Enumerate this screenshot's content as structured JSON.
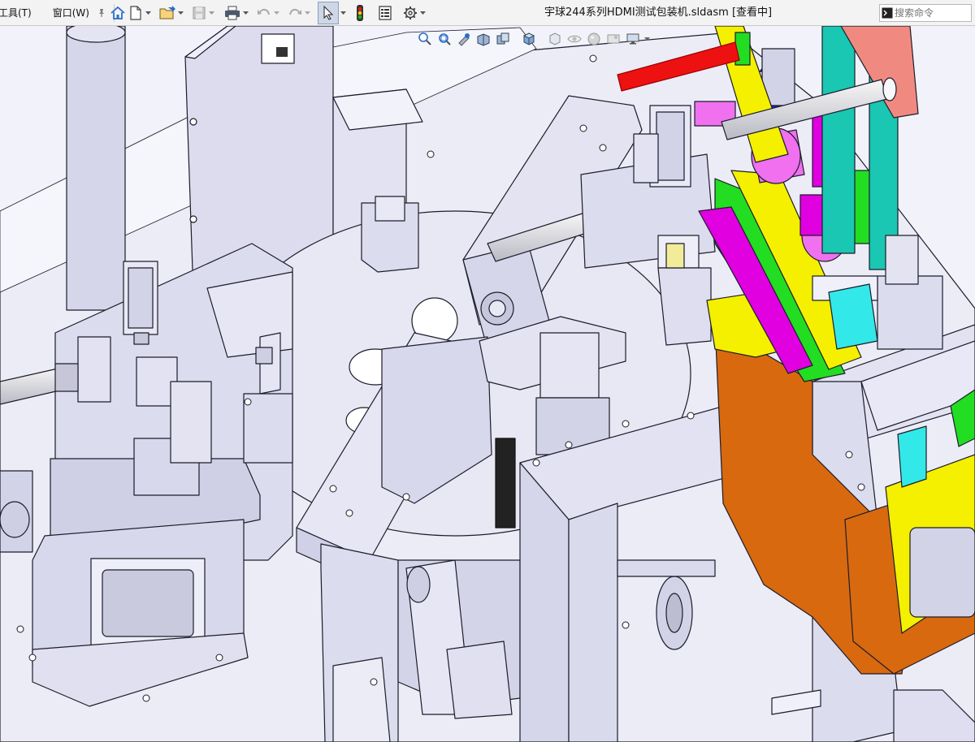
{
  "menu": {
    "items": [
      {
        "label": "工具(T)"
      },
      {
        "label": "窗口(W)"
      }
    ]
  },
  "window": {
    "title": "宇球244系列HDMI测试包装机.sldasm [查看中]"
  },
  "search": {
    "placeholder": "搜索命令"
  },
  "colors": {
    "accent": "#2a6fc9",
    "model_grey": "#dcdcf0",
    "edge": "#1c1c2a",
    "orange": "#d8690f",
    "green": "#22dd22",
    "yellow": "#f4f000",
    "magenta": "#e000e0",
    "pink": "#f070f0",
    "cyan": "#33e8e8",
    "red": "#ee1111",
    "salmon": "#f08a80",
    "teal": "#1ac7b2",
    "blue": "#1a1aee"
  }
}
